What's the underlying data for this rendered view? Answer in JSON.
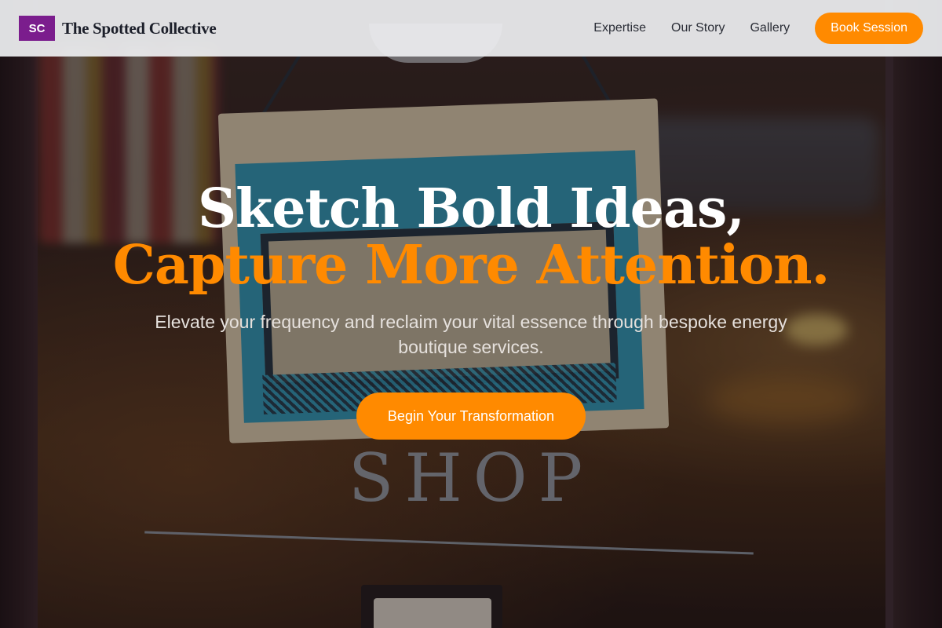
{
  "brand": {
    "badge": "SC",
    "name": "The Spotted Collective"
  },
  "nav": {
    "links": [
      "Expertise",
      "Our Story",
      "Gallery"
    ],
    "cta": "Book Session"
  },
  "hero": {
    "title_line1": "Sketch Bold Ideas,",
    "title_line2": "Capture More Attention.",
    "subtitle": "Elevate your frequency and reclaim your vital essence through bespoke energy boutique services.",
    "cta": "Begin Your Transformation",
    "background_text": "SHOP"
  },
  "colors": {
    "accent": "#ff8a00",
    "brand_badge": "#7b1d8d",
    "navbar": "#ebecee",
    "title": "#ffffff"
  }
}
